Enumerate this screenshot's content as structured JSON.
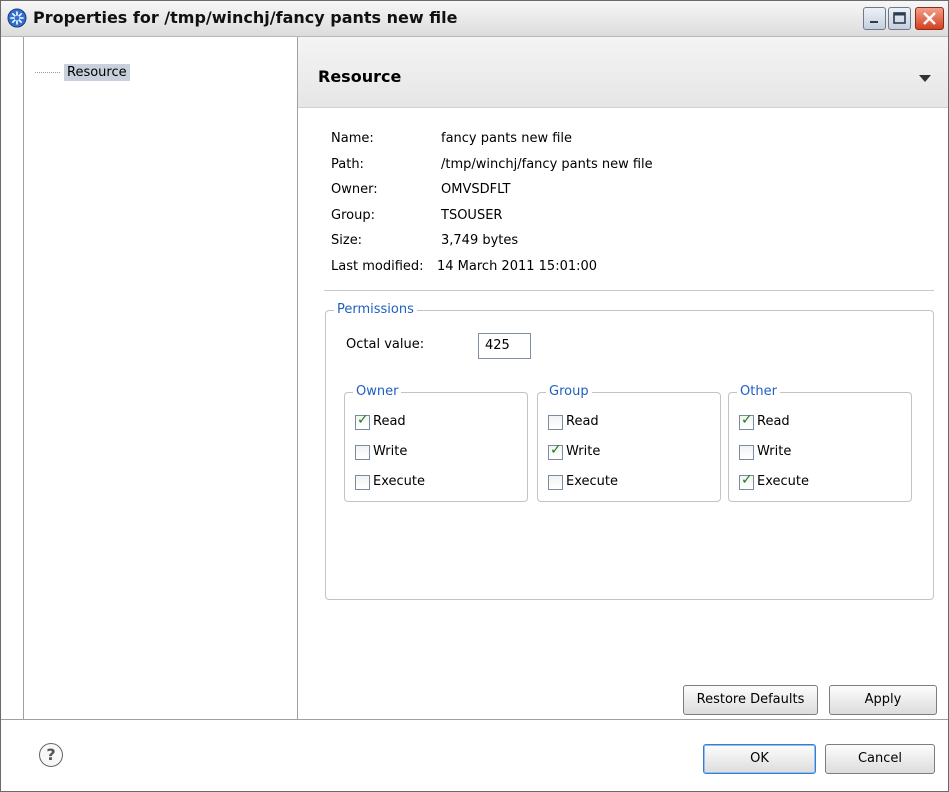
{
  "window": {
    "title": "Properties for /tmp/winchj/fancy pants new file",
    "icon": "eclipse-gear-icon"
  },
  "tree": {
    "items": [
      {
        "label": "Resource",
        "selected": true
      }
    ]
  },
  "page": {
    "title": "Resource",
    "info": [
      {
        "label": "Name:",
        "value": "fancy pants new file"
      },
      {
        "label": "Path:",
        "value": "/tmp/winchj/fancy pants new file"
      },
      {
        "label": "Owner:",
        "value": "OMVSDFLT"
      },
      {
        "label": "Group:",
        "value": "TSOUSER"
      },
      {
        "label": "Size:",
        "value": "3,749 bytes"
      },
      {
        "label": "Last modified:",
        "value": "14 March 2011 15:01:00"
      }
    ],
    "permissions": {
      "legend": "Permissions",
      "octal_label": "Octal value:",
      "octal_value": "425",
      "groups": [
        {
          "legend": "Owner",
          "items": [
            {
              "label": "Read",
              "checked": true
            },
            {
              "label": "Write",
              "checked": false
            },
            {
              "label": "Execute",
              "checked": false
            }
          ]
        },
        {
          "legend": "Group",
          "items": [
            {
              "label": "Read",
              "checked": false
            },
            {
              "label": "Write",
              "checked": true
            },
            {
              "label": "Execute",
              "checked": false
            }
          ]
        },
        {
          "legend": "Other",
          "items": [
            {
              "label": "Read",
              "checked": true
            },
            {
              "label": "Write",
              "checked": false
            },
            {
              "label": "Execute",
              "checked": true
            }
          ]
        }
      ]
    },
    "restore_defaults_label": "Restore Defaults",
    "apply_label": "Apply"
  },
  "footer": {
    "help_icon": "help-icon",
    "help_glyph": "?",
    "ok_label": "OK",
    "cancel_label": "Cancel"
  },
  "colors": {
    "legend": "#1f5fbf",
    "selection": "#c8d0dc",
    "check": "#1a7f1a"
  }
}
